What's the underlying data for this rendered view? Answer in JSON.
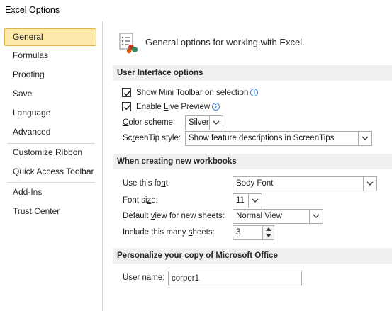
{
  "window": {
    "title": "Excel Options"
  },
  "sidebar": {
    "items": [
      {
        "label": "General",
        "selected": true
      },
      {
        "label": "Formulas"
      },
      {
        "label": "Proofing"
      },
      {
        "label": "Save"
      },
      {
        "label": "Language"
      },
      {
        "label": "Advanced"
      },
      {
        "label": "Customize Ribbon"
      },
      {
        "label": "Quick Access Toolbar"
      },
      {
        "label": "Add-Ins"
      },
      {
        "label": "Trust Center"
      }
    ]
  },
  "header": {
    "icon": "general-options-icon",
    "text": "General options for working with Excel."
  },
  "ui_options": {
    "heading": "User Interface options",
    "mini_toolbar": {
      "label_pre": "Show ",
      "label_key": "M",
      "label_post": "ini Toolbar on selection",
      "checked": true
    },
    "live_preview": {
      "label_pre": "Enable ",
      "label_key": "L",
      "label_post": "ive Preview",
      "checked": true
    },
    "color_scheme": {
      "label_pre": "",
      "label_key": "C",
      "label_post": "olor scheme:",
      "value": "Silver"
    },
    "screentip": {
      "label_pre": "Sc",
      "label_key": "r",
      "label_post": "eenTip style:",
      "value": "Show feature descriptions in ScreenTips"
    }
  },
  "new_workbooks": {
    "heading": "When creating new workbooks",
    "font": {
      "label_pre": "Use this fo",
      "label_key": "n",
      "label_post": "t:",
      "value": "Body Font"
    },
    "font_size": {
      "label_pre": "Font si",
      "label_key": "z",
      "label_post": "e:",
      "value": "11"
    },
    "default_view": {
      "label_pre": "Default ",
      "label_key": "v",
      "label_post": "iew for new sheets:",
      "value": "Normal View"
    },
    "sheets": {
      "label_pre": "Include this many ",
      "label_key": "s",
      "label_post": "heets:",
      "value": "3"
    }
  },
  "personalize": {
    "heading": "Personalize your copy of Microsoft Office",
    "username": {
      "label_pre": "",
      "label_key": "U",
      "label_post": "ser name:",
      "value": "corpor1"
    }
  },
  "colors": {
    "selected_bg": "#fde9a9",
    "selected_border": "#e5b34b",
    "section_bg": "#f0f0f0",
    "info_blue": "#3a7bd5"
  }
}
